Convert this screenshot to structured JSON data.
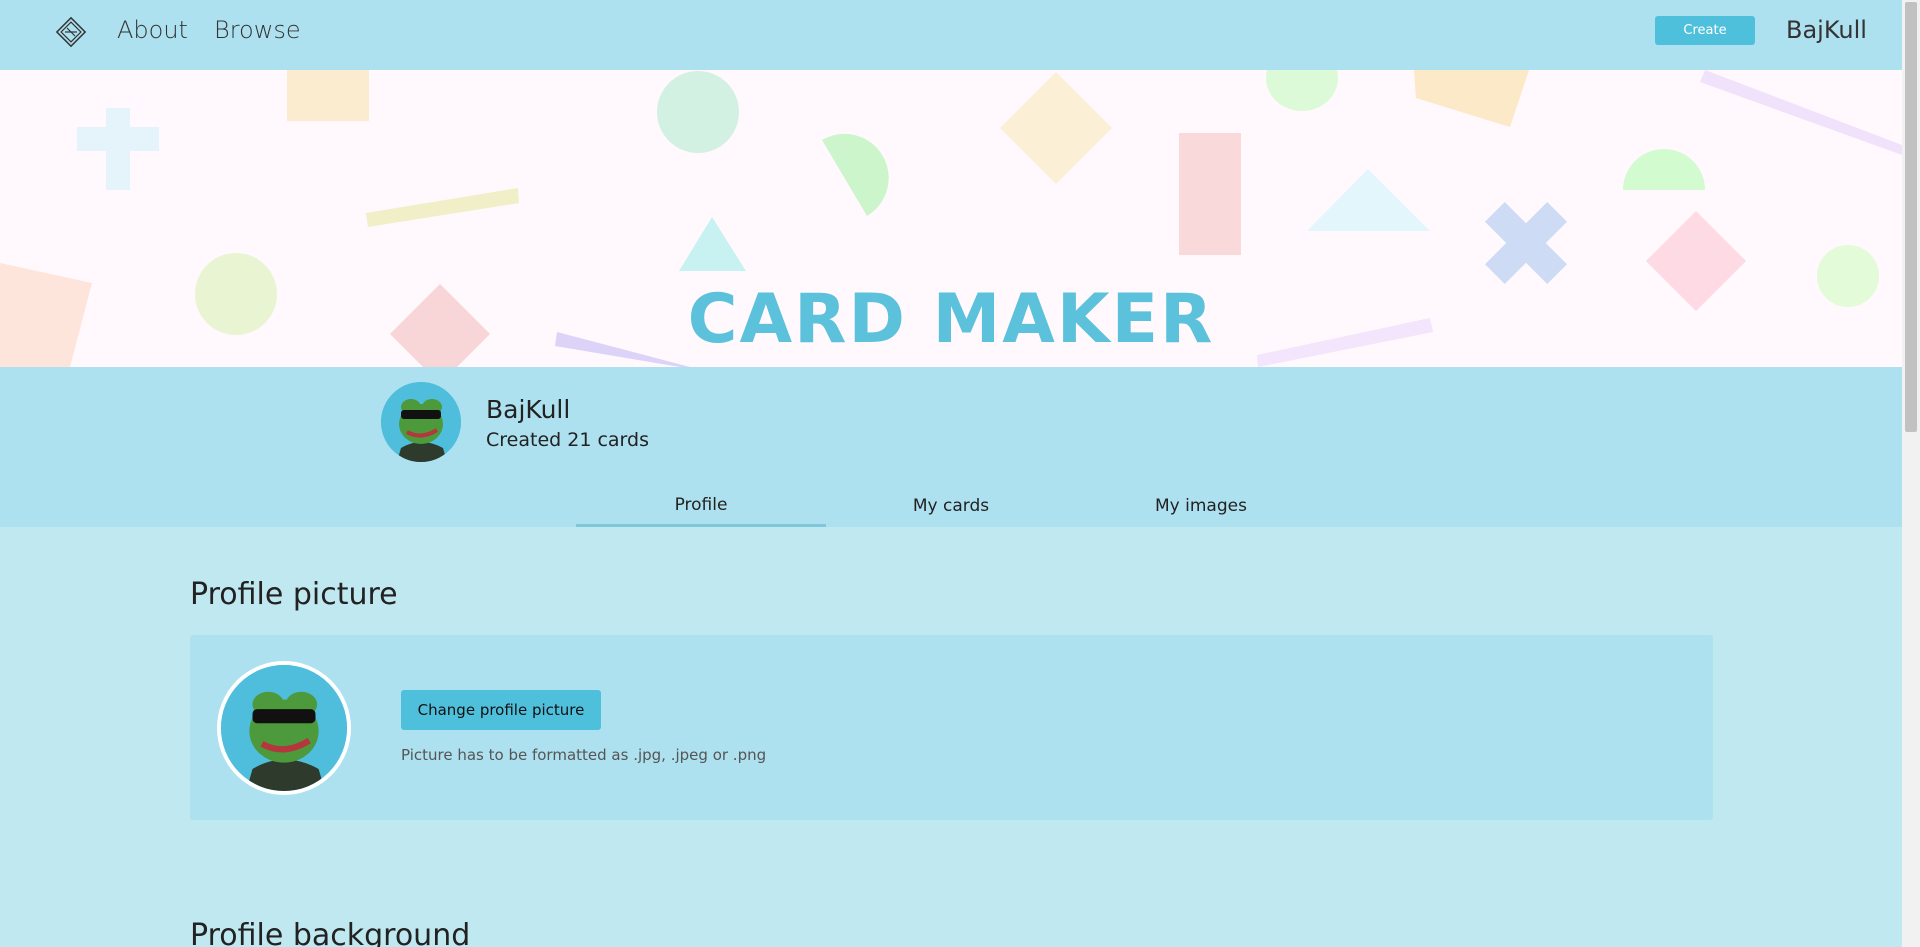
{
  "nav": {
    "about": "About",
    "browse": "Browse",
    "create": "Create",
    "user": "BajKull"
  },
  "banner": {
    "title": "CARD MAKER"
  },
  "profile": {
    "username": "BajKull",
    "created": "Created 21 cards"
  },
  "tabs": [
    "Profile",
    "My cards",
    "My images"
  ],
  "active_tab": "Profile",
  "sections": {
    "picture_title": "Profile picture",
    "change_button": "Change profile picture",
    "hint": "Picture has to be formatted as .jpg, .jpeg or .png",
    "background_title": "Profile background"
  },
  "colors": {
    "navbar": "#aee1ef",
    "accent": "#4fc0dc",
    "page": "#bfe8f1",
    "banner_bg": "#fff8fd"
  },
  "icons": {
    "logo": "diamond-logo-icon",
    "avatar": "frog-sunglasses-avatar"
  }
}
